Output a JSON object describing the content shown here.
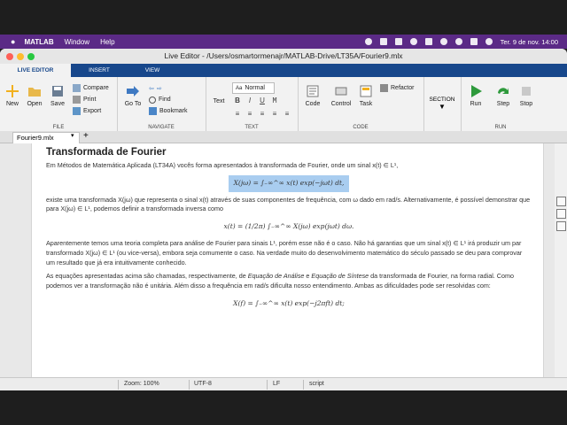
{
  "menubar": {
    "app": "MATLAB",
    "items": [
      "Window",
      "Help"
    ],
    "datetime": "Ter. 9 de nov.  14:00"
  },
  "window": {
    "title": "Live Editor - /Users/osmartormenajr/MATLAB-Drive/LT35A/Fourier9.mlx"
  },
  "ribbon_tabs": [
    "LIVE EDITOR",
    "INSERT",
    "VIEW"
  ],
  "ribbon": {
    "file": {
      "new": "New",
      "open": "Open",
      "save": "Save",
      "compare": "Compare",
      "print": "Print",
      "export": "Export",
      "label": "FILE"
    },
    "navigate": {
      "goto": "Go To",
      "find": "Find",
      "bookmark": "Bookmark",
      "label": "NAVIGATE"
    },
    "text": {
      "text": "Text",
      "style": "Normal",
      "bold": "B",
      "italic": "I",
      "underline": "U",
      "mono": "M",
      "label": "TEXT"
    },
    "code": {
      "code": "Code",
      "control": "Control",
      "task": "Task",
      "refactor": "Refactor",
      "label": "CODE"
    },
    "section": {
      "label": "SECTION"
    },
    "run": {
      "run": "Run",
      "step": "Step",
      "stop": "Stop",
      "label": "RUN"
    }
  },
  "doc_tab": {
    "name": "Fourier9.mlx",
    "add": "+"
  },
  "doc": {
    "title": "Transformada de Fourier",
    "p1": "Em Métodos de Matemática Aplicada (LT34A) vocês forma apresentados à transformada de Fourier, onde um sinal x(t) ∈ L¹,",
    "eq1": "X(jω) = ∫₋∞^∞ x(t) exp(−jωt) dt,",
    "p2": "existe uma transformada X(jω) que representa o sinal x(t) através de suas componentes de frequência, com ω dado em rad/s. Alternativamente, é possível demonstrar que para X(jω) ∈ L¹, podemos definir a transformada inversa como",
    "eq2": "x(t) = (1/2π) ∫₋∞^∞ X(jω) exp(jωt) dω.",
    "p3": "Aparentemente temos uma teoria completa para análise de Fourier para sinais L¹, porém esse não é o caso. Não há garantias que um sinal x(t) ∈ L¹ irá produzir um par transformado X(jω) ∈ L¹ (ou vice-versa), embora seja comumente o caso. Na verdade muito do desenvolvimento matemático do século passado se deu para comprovar um resultado que já era intuitivamente conhecido.",
    "p4_a": "As equações apresentadas acima são chamadas, respectivamente, de ",
    "p4_em1": "Equação de Análise",
    "p4_b": " e ",
    "p4_em2": "Equação de Síntese",
    "p4_c": " da transformada de Fourier, na forma radial. Como podemos ver a transformação não é unitária. Além disso a frequência em rad/s dificulta nosso entendimento. Ambas as dificuldades pode ser resolvidas com:",
    "eq3": "X(f) = ∫₋∞^∞ x(t) exp(−j2πft) dt;"
  },
  "status": {
    "zoom": "Zoom: 100%",
    "encoding": "UTF-8",
    "eol": "LF",
    "mode": "script"
  },
  "colors": {
    "menubar": "#5b2a86",
    "tabs": "#17478b",
    "selection": "#a9cdf0"
  }
}
